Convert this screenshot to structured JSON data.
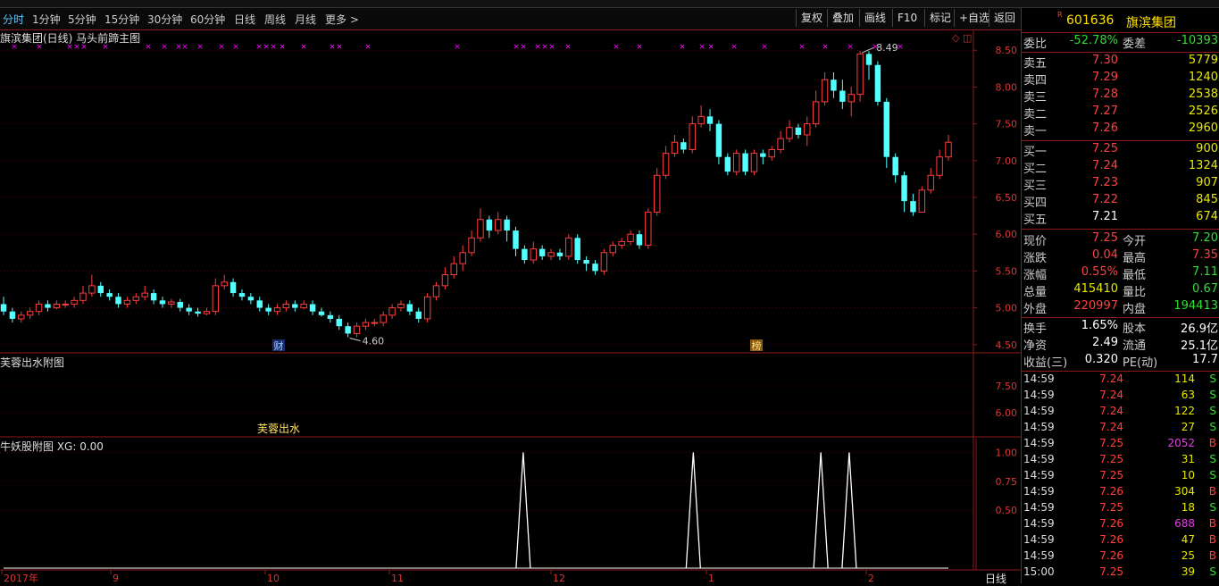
{
  "toolbar": {
    "periods": [
      "分时",
      "1分钟",
      "5分钟",
      "15分钟",
      "30分钟",
      "60分钟",
      "日线",
      "周线",
      "月线",
      "更多 >"
    ],
    "buttons": [
      "复权",
      "叠加",
      "画线",
      "F10",
      "标记",
      "+自选",
      "返回"
    ]
  },
  "main_panel": {
    "title": "旗滨集团(日线) 马头前蹄主图",
    "y_ticks": [
      "8.50",
      "8.00",
      "7.50",
      "7.00",
      "6.50",
      "6.00",
      "5.50",
      "5.00",
      "4.50"
    ],
    "high_label": "8.49",
    "low_label": "4.60",
    "markers": [
      "财",
      "榜"
    ]
  },
  "sub_panel1": {
    "title": "芙蓉出水附图",
    "y_ticks": [
      "7.50",
      "6.00"
    ],
    "label": "芙蓉出水"
  },
  "sub_panel2": {
    "title": "牛妖股附图 XG: 0.00",
    "y_ticks": [
      "1.00",
      "0.75",
      "0.50"
    ]
  },
  "x_axis": {
    "labels": [
      "2017年",
      "9",
      "10",
      "11",
      "12",
      "1",
      "2"
    ],
    "period_label": "日线"
  },
  "chart_data": {
    "type": "candlestick",
    "y_range": [
      4.4,
      8.6
    ],
    "candles": [
      [
        5.05,
        4.95,
        5.15,
        4.9
      ],
      [
        4.95,
        4.85,
        5.0,
        4.8
      ],
      [
        4.85,
        4.9,
        4.95,
        4.8
      ],
      [
        4.9,
        4.95,
        5.0,
        4.85
      ],
      [
        4.95,
        5.05,
        5.1,
        4.9
      ],
      [
        5.05,
        5.0,
        5.1,
        4.95
      ],
      [
        5.0,
        5.05,
        5.1,
        4.98
      ],
      [
        5.05,
        5.05,
        5.1,
        5.0
      ],
      [
        5.05,
        5.1,
        5.15,
        5.0
      ],
      [
        5.1,
        5.2,
        5.3,
        5.05
      ],
      [
        5.2,
        5.3,
        5.45,
        5.15
      ],
      [
        5.3,
        5.2,
        5.35,
        5.15
      ],
      [
        5.2,
        5.15,
        5.25,
        5.1
      ],
      [
        5.15,
        5.05,
        5.2,
        5.0
      ],
      [
        5.05,
        5.1,
        5.15,
        5.0
      ],
      [
        5.1,
        5.15,
        5.2,
        5.05
      ],
      [
        5.15,
        5.2,
        5.3,
        5.1
      ],
      [
        5.2,
        5.1,
        5.25,
        5.05
      ],
      [
        5.1,
        5.05,
        5.15,
        5.0
      ],
      [
        5.05,
        5.08,
        5.12,
        5.0
      ],
      [
        5.08,
        5.0,
        5.12,
        4.95
      ],
      [
        5.0,
        4.95,
        5.05,
        4.9
      ],
      [
        4.95,
        4.92,
        5.0,
        4.88
      ],
      [
        4.92,
        4.95,
        5.0,
        4.9
      ],
      [
        4.95,
        5.3,
        5.4,
        4.9
      ],
      [
        5.3,
        5.35,
        5.45,
        5.25
      ],
      [
        5.35,
        5.2,
        5.4,
        5.15
      ],
      [
        5.2,
        5.15,
        5.25,
        5.1
      ],
      [
        5.15,
        5.1,
        5.2,
        5.05
      ],
      [
        5.1,
        5.0,
        5.15,
        4.95
      ],
      [
        5.0,
        4.95,
        5.05,
        4.9
      ],
      [
        4.95,
        5.0,
        5.05,
        4.9
      ],
      [
        5.0,
        5.05,
        5.1,
        4.95
      ],
      [
        5.05,
        5.0,
        5.1,
        4.95
      ],
      [
        5.0,
        5.05,
        5.1,
        4.98
      ],
      [
        5.05,
        4.95,
        5.1,
        4.9
      ],
      [
        4.95,
        4.9,
        5.0,
        4.88
      ],
      [
        4.9,
        4.85,
        4.95,
        4.8
      ],
      [
        4.85,
        4.75,
        4.9,
        4.7
      ],
      [
        4.75,
        4.65,
        4.8,
        4.6
      ],
      [
        4.65,
        4.75,
        4.8,
        4.6
      ],
      [
        4.75,
        4.8,
        4.85,
        4.7
      ],
      [
        4.8,
        4.8,
        4.85,
        4.75
      ],
      [
        4.8,
        4.9,
        4.95,
        4.75
      ],
      [
        4.9,
        5.0,
        5.05,
        4.85
      ],
      [
        5.0,
        5.05,
        5.1,
        4.95
      ],
      [
        5.05,
        4.95,
        5.1,
        4.9
      ],
      [
        4.95,
        4.85,
        5.0,
        4.8
      ],
      [
        4.85,
        5.15,
        5.2,
        4.8
      ],
      [
        5.15,
        5.3,
        5.35,
        5.1
      ],
      [
        5.3,
        5.45,
        5.55,
        5.25
      ],
      [
        5.45,
        5.6,
        5.7,
        5.4
      ],
      [
        5.6,
        5.75,
        5.85,
        5.5
      ],
      [
        5.75,
        5.95,
        6.05,
        5.7
      ],
      [
        5.95,
        6.2,
        6.35,
        5.9
      ],
      [
        6.2,
        6.05,
        6.25,
        5.95
      ],
      [
        6.05,
        6.2,
        6.3,
        6.0
      ],
      [
        6.2,
        6.05,
        6.25,
        5.9
      ],
      [
        6.05,
        5.8,
        6.1,
        5.7
      ],
      [
        5.8,
        5.65,
        5.85,
        5.6
      ],
      [
        5.65,
        5.8,
        5.9,
        5.6
      ],
      [
        5.8,
        5.7,
        5.85,
        5.65
      ],
      [
        5.7,
        5.75,
        5.8,
        5.65
      ],
      [
        5.75,
        5.7,
        5.8,
        5.65
      ],
      [
        5.7,
        5.95,
        6.0,
        5.65
      ],
      [
        5.95,
        5.65,
        6.0,
        5.6
      ],
      [
        5.65,
        5.6,
        5.7,
        5.5
      ],
      [
        5.6,
        5.5,
        5.65,
        5.45
      ],
      [
        5.5,
        5.75,
        5.8,
        5.45
      ],
      [
        5.75,
        5.85,
        5.9,
        5.7
      ],
      [
        5.85,
        5.9,
        5.95,
        5.8
      ],
      [
        5.9,
        6.0,
        6.05,
        5.85
      ],
      [
        6.0,
        5.85,
        6.05,
        5.8
      ],
      [
        5.85,
        6.3,
        6.35,
        5.8
      ],
      [
        6.3,
        6.8,
        6.9,
        6.25
      ],
      [
        6.8,
        7.1,
        7.2,
        6.75
      ],
      [
        7.1,
        7.25,
        7.35,
        7.05
      ],
      [
        7.25,
        7.15,
        7.3,
        7.1
      ],
      [
        7.15,
        7.5,
        7.6,
        7.1
      ],
      [
        7.5,
        7.6,
        7.75,
        7.45
      ],
      [
        7.6,
        7.5,
        7.7,
        7.4
      ],
      [
        7.5,
        7.05,
        7.55,
        6.95
      ],
      [
        7.05,
        6.85,
        7.1,
        6.8
      ],
      [
        6.85,
        7.1,
        7.15,
        6.8
      ],
      [
        7.1,
        6.85,
        7.15,
        6.8
      ],
      [
        6.85,
        7.1,
        7.15,
        6.8
      ],
      [
        7.1,
        7.05,
        7.15,
        6.95
      ],
      [
        7.05,
        7.15,
        7.2,
        7.0
      ],
      [
        7.15,
        7.3,
        7.4,
        7.1
      ],
      [
        7.3,
        7.45,
        7.55,
        7.25
      ],
      [
        7.45,
        7.35,
        7.5,
        7.3
      ],
      [
        7.35,
        7.5,
        7.6,
        7.2
      ],
      [
        7.5,
        7.8,
        7.95,
        7.45
      ],
      [
        7.8,
        8.1,
        8.2,
        7.75
      ],
      [
        8.1,
        7.95,
        8.2,
        7.85
      ],
      [
        7.95,
        7.8,
        8.1,
        7.7
      ],
      [
        7.8,
        7.9,
        8.0,
        7.6
      ],
      [
        7.9,
        8.45,
        8.49,
        7.8
      ],
      [
        8.45,
        8.3,
        8.49,
        8.1
      ],
      [
        8.3,
        7.8,
        8.35,
        7.75
      ],
      [
        7.8,
        7.05,
        7.85,
        6.9
      ],
      [
        7.05,
        6.8,
        7.1,
        6.7
      ],
      [
        6.8,
        6.45,
        6.85,
        6.3
      ],
      [
        6.45,
        6.3,
        6.55,
        6.25
      ],
      [
        6.3,
        6.6,
        6.65,
        6.3
      ],
      [
        6.6,
        6.8,
        6.9,
        6.55
      ],
      [
        6.8,
        7.05,
        7.15,
        6.75
      ],
      [
        7.05,
        7.25,
        7.35,
        7.0
      ]
    ],
    "signals_x_fraction": [
      0.55,
      0.73,
      0.865,
      0.895
    ],
    "signal_value": 1.0
  },
  "quote": {
    "code": "601636",
    "name": "旗滨集团",
    "r_badge": "R",
    "weibi_label": "委比",
    "weibi": "-52.78%",
    "weicha_label": "委差",
    "weicha": "-10393",
    "sells": [
      {
        "label": "卖五",
        "price": "7.30",
        "vol": "5779"
      },
      {
        "label": "卖四",
        "price": "7.29",
        "vol": "1240"
      },
      {
        "label": "卖三",
        "price": "7.28",
        "vol": "2538"
      },
      {
        "label": "卖二",
        "price": "7.27",
        "vol": "2526"
      },
      {
        "label": "卖一",
        "price": "7.26",
        "vol": "2960"
      }
    ],
    "buys": [
      {
        "label": "买一",
        "price": "7.25",
        "vol": "900"
      },
      {
        "label": "买二",
        "price": "7.24",
        "vol": "1324"
      },
      {
        "label": "买三",
        "price": "7.23",
        "vol": "907"
      },
      {
        "label": "买四",
        "price": "7.22",
        "vol": "845"
      },
      {
        "label": "买五",
        "price": "7.21",
        "vol": "674"
      }
    ],
    "stats": [
      {
        "l1": "现价",
        "v1": "7.25",
        "c1": "red",
        "l2": "今开",
        "v2": "7.20",
        "c2": "green"
      },
      {
        "l1": "涨跌",
        "v1": "0.04",
        "c1": "red",
        "l2": "最高",
        "v2": "7.35",
        "c2": "red"
      },
      {
        "l1": "涨幅",
        "v1": "0.55%",
        "c1": "red",
        "l2": "最低",
        "v2": "7.11",
        "c2": "green"
      },
      {
        "l1": "总量",
        "v1": "415410",
        "c1": "yellow",
        "l2": "量比",
        "v2": "0.67",
        "c2": "green"
      },
      {
        "l1": "外盘",
        "v1": "220997",
        "c1": "red",
        "l2": "内盘",
        "v2": "194413",
        "c2": "green"
      }
    ],
    "fund": [
      {
        "l1": "换手",
        "v1": "1.65%",
        "l2": "股本",
        "v2": "26.9亿"
      },
      {
        "l1": "净资",
        "v1": "2.49",
        "l2": "流通",
        "v2": "25.1亿"
      },
      {
        "l1": "收益(三)",
        "v1": "0.320",
        "l2": "PE(动)",
        "v2": "17.7"
      }
    ],
    "ticks": [
      {
        "t": "14:59",
        "p": "7.24",
        "pc": "red",
        "v": "114",
        "vc": "yellow",
        "d": "S"
      },
      {
        "t": "14:59",
        "p": "7.24",
        "pc": "red",
        "v": "63",
        "vc": "yellow",
        "d": "S"
      },
      {
        "t": "14:59",
        "p": "7.24",
        "pc": "red",
        "v": "122",
        "vc": "yellow",
        "d": "S"
      },
      {
        "t": "14:59",
        "p": "7.24",
        "pc": "red",
        "v": "27",
        "vc": "yellow",
        "d": "S"
      },
      {
        "t": "14:59",
        "p": "7.25",
        "pc": "red",
        "v": "2052",
        "vc": "purple",
        "d": "B"
      },
      {
        "t": "14:59",
        "p": "7.25",
        "pc": "red",
        "v": "31",
        "vc": "yellow",
        "d": "S"
      },
      {
        "t": "14:59",
        "p": "7.25",
        "pc": "red",
        "v": "10",
        "vc": "yellow",
        "d": "S"
      },
      {
        "t": "14:59",
        "p": "7.26",
        "pc": "red",
        "v": "304",
        "vc": "yellow",
        "d": "B"
      },
      {
        "t": "14:59",
        "p": "7.25",
        "pc": "red",
        "v": "18",
        "vc": "yellow",
        "d": "S"
      },
      {
        "t": "14:59",
        "p": "7.26",
        "pc": "red",
        "v": "688",
        "vc": "purple",
        "d": "B"
      },
      {
        "t": "14:59",
        "p": "7.26",
        "pc": "red",
        "v": "47",
        "vc": "yellow",
        "d": "B"
      },
      {
        "t": "14:59",
        "p": "7.26",
        "pc": "red",
        "v": "25",
        "vc": "yellow",
        "d": "B"
      },
      {
        "t": "15:00",
        "p": "7.25",
        "pc": "red",
        "v": "39",
        "vc": "yellow",
        "d": "S"
      }
    ]
  },
  "colors": {
    "up": "#ff3c3c",
    "down": "#54ffff",
    "grid": "#8b1a1a",
    "signal": "#ffffff",
    "marker": "#ff00ff"
  }
}
